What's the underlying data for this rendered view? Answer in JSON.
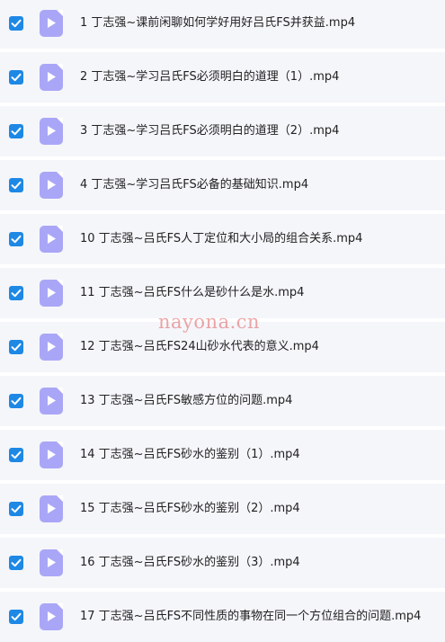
{
  "files": [
    {
      "name": "1 丁志强~课前闲聊如何学好用好吕氏FS并获益.mp4",
      "checked": true
    },
    {
      "name": "2 丁志强~学习吕氏FS必须明白的道理（1）.mp4",
      "checked": true
    },
    {
      "name": "3 丁志强~学习吕氏FS必须明白的道理（2）.mp4",
      "checked": true
    },
    {
      "name": "4 丁志强~学习吕氏FS必备的基础知识.mp4",
      "checked": true
    },
    {
      "name": "10 丁志强~吕氏FS人丁定位和大小局的组合关系.mp4",
      "checked": true
    },
    {
      "name": "11 丁志强~吕氏FS什么是砂什么是水.mp4",
      "checked": true
    },
    {
      "name": "12 丁志强~吕氏FS24山砂水代表的意义.mp4",
      "checked": true
    },
    {
      "name": "13 丁志强~吕氏FS敏感方位的问题.mp4",
      "checked": true
    },
    {
      "name": "14 丁志强~吕氏FS砂水的鉴别（1）.mp4",
      "checked": true
    },
    {
      "name": "15 丁志强~吕氏FS砂水的鉴别（2）.mp4",
      "checked": true
    },
    {
      "name": "16 丁志强~吕氏FS砂水的鉴别（3）.mp4",
      "checked": true
    },
    {
      "name": "17 丁志强~吕氏FS不同性质的事物在同一个方位组合的问题.mp4",
      "checked": true
    }
  ],
  "watermark": "nayona.cn",
  "colors": {
    "row_bg": "#f5f6fa",
    "checkbox": "#1e88e5",
    "file_icon": "#aaa6f7"
  }
}
